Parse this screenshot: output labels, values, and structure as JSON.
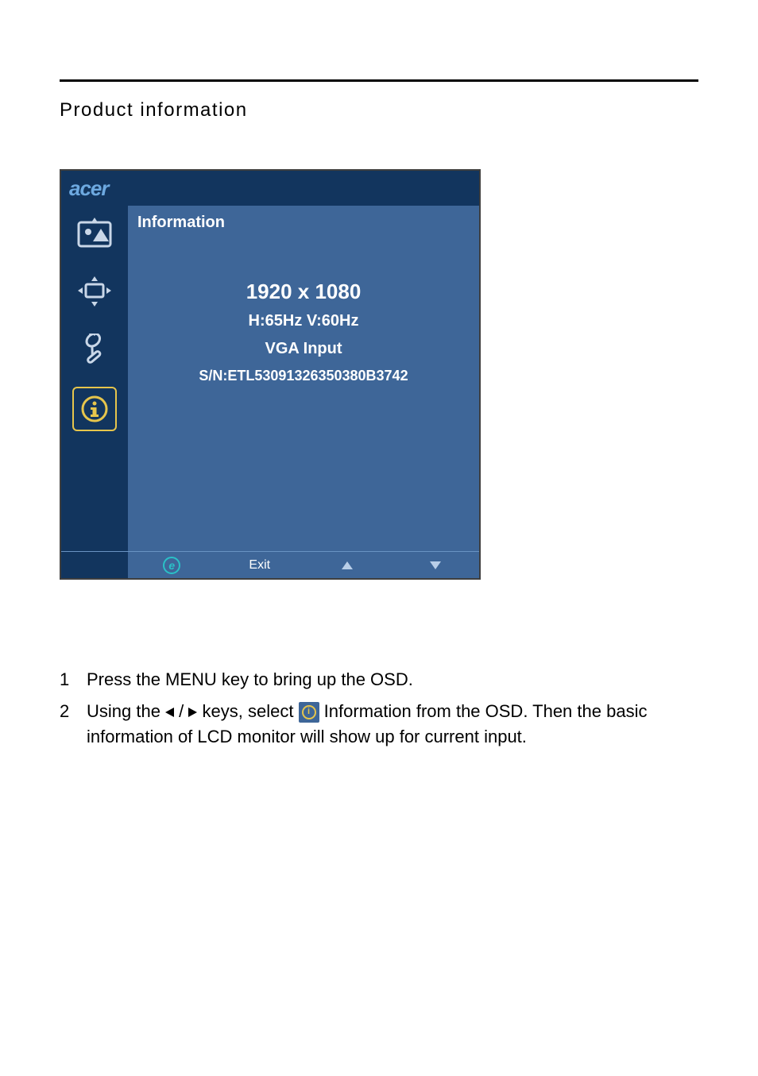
{
  "page": {
    "title": "Product information"
  },
  "osd": {
    "brand": "acer",
    "header": "Information",
    "resolution": "1920 x 1080",
    "freq": "H:65Hz  V:60Hz",
    "input": "VGA Input",
    "serial": "S/N:ETL53091326350380B3742",
    "footer": {
      "exit": "Exit"
    }
  },
  "instructions": {
    "items": [
      {
        "num": "1",
        "text": "Press the MENU key to bring up the OSD."
      },
      {
        "num": "2",
        "pre": "Using the ",
        "mid": " keys, select ",
        "post": " Information from the OSD. Then the basic information of LCD monitor will show up for current input."
      }
    ]
  }
}
